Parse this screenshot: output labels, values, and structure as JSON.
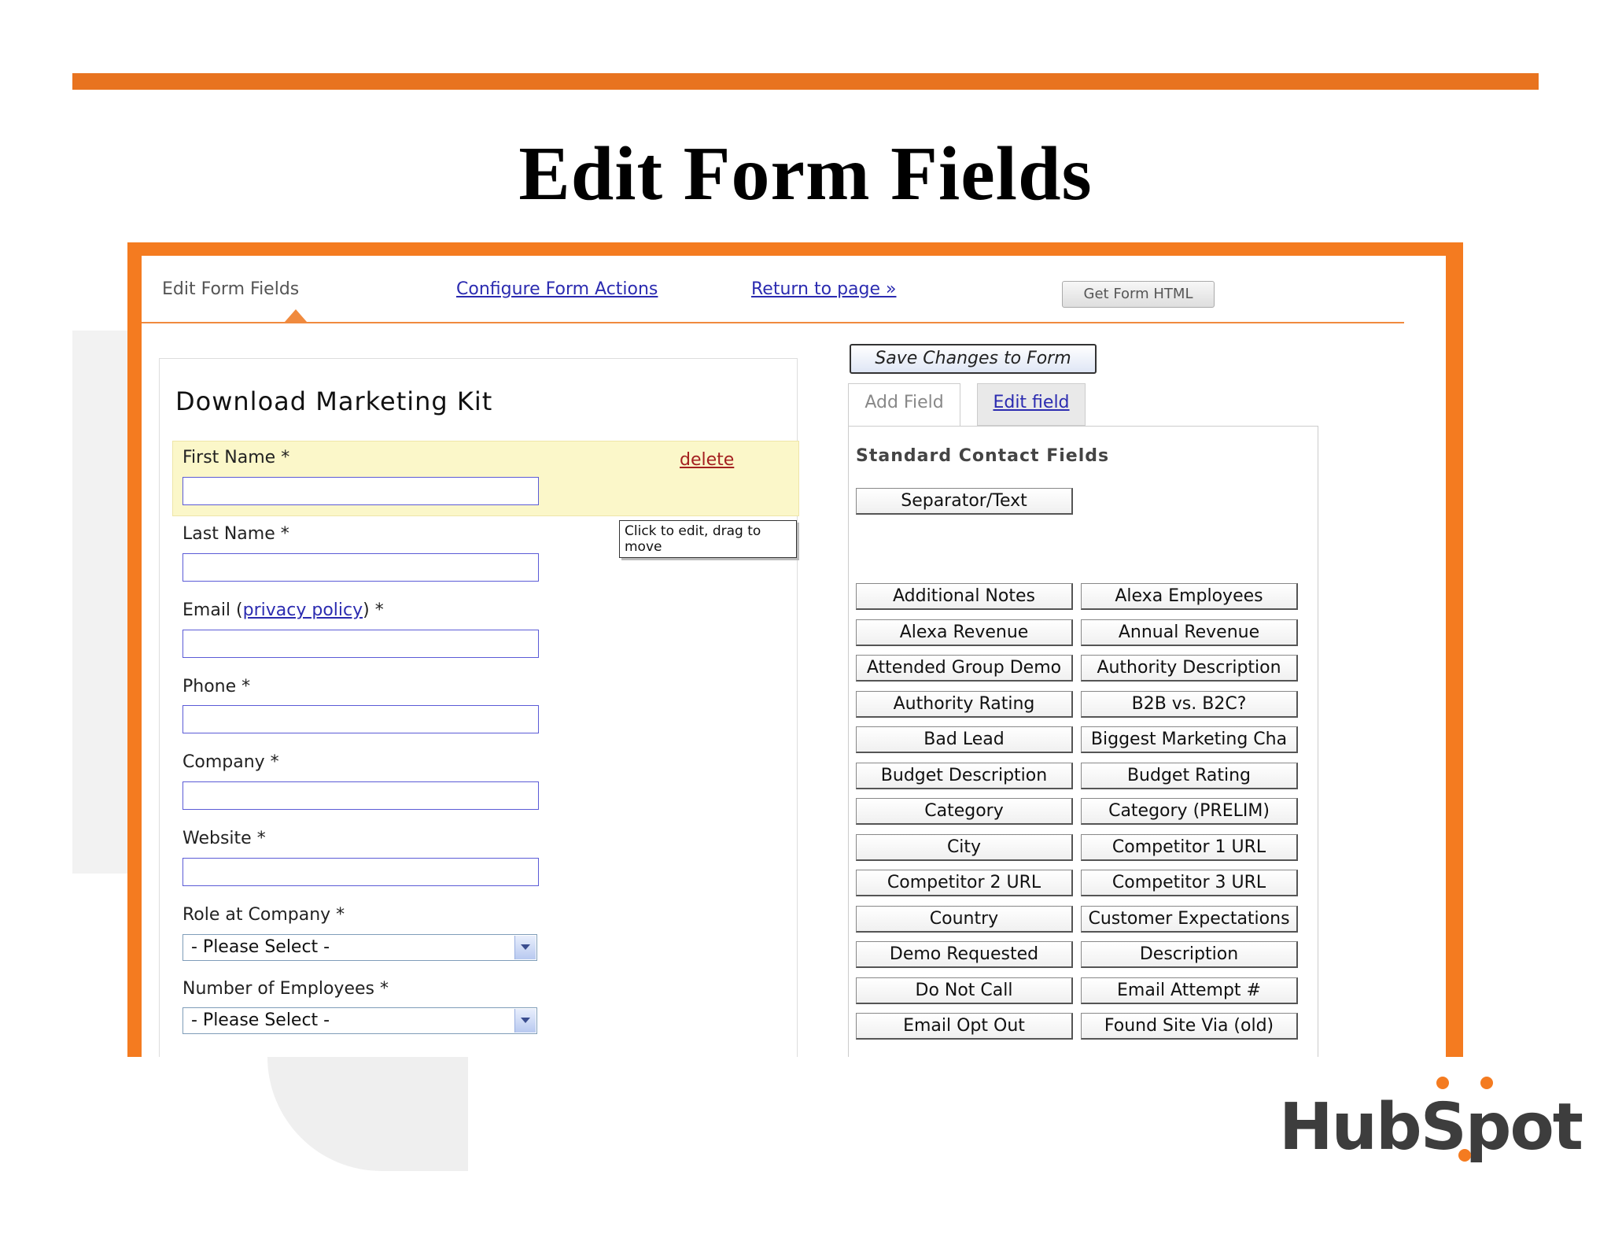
{
  "slide": {
    "title": "Edit Form Fields"
  },
  "nav": {
    "active_tab": "Edit Form Fields",
    "configure_link": "Configure Form Actions",
    "return_link": "Return to page »",
    "get_html_button": "Get Form HTML"
  },
  "form": {
    "title": "Download Marketing Kit",
    "delete_link": "delete",
    "tooltip": "Click to edit, drag to move",
    "fields": [
      {
        "label": "First Name *"
      },
      {
        "label": "Last Name *"
      },
      {
        "label_prefix": "Email (",
        "label_link": "privacy policy",
        "label_suffix": ") *"
      },
      {
        "label": "Phone *"
      },
      {
        "label": "Company *"
      },
      {
        "label": "Website *"
      },
      {
        "label": "Role at Company *",
        "value": "- Please Select -"
      },
      {
        "label": "Number of Employees *",
        "value": "- Please Select -"
      }
    ]
  },
  "editor": {
    "save_button": "Save Changes to Form",
    "tabs": [
      "Add Field",
      "Edit field"
    ],
    "section_heading": "Standard Contact Fields",
    "separator_button": "Separator/Text",
    "field_buttons": [
      "Additional Notes",
      "Alexa Employees",
      "Alexa Revenue",
      "Annual Revenue",
      "Attended Group Demo",
      "Authority Description",
      "Authority Rating",
      "B2B vs. B2C?",
      "Bad Lead",
      "Biggest Marketing Cha",
      "Budget Description",
      "Budget Rating",
      "Category",
      "Category (PRELIM)",
      "City",
      "Competitor 1 URL",
      "Competitor 2 URL",
      "Competitor 3 URL",
      "Country",
      "Customer Expectations",
      "Demo Requested",
      "Description",
      "Do Not Call",
      "Email Attempt #",
      "Email Opt Out",
      "Found Site Via (old)"
    ]
  },
  "brand": {
    "logo_text": "HubSpot",
    "accent": "#f47b20"
  }
}
